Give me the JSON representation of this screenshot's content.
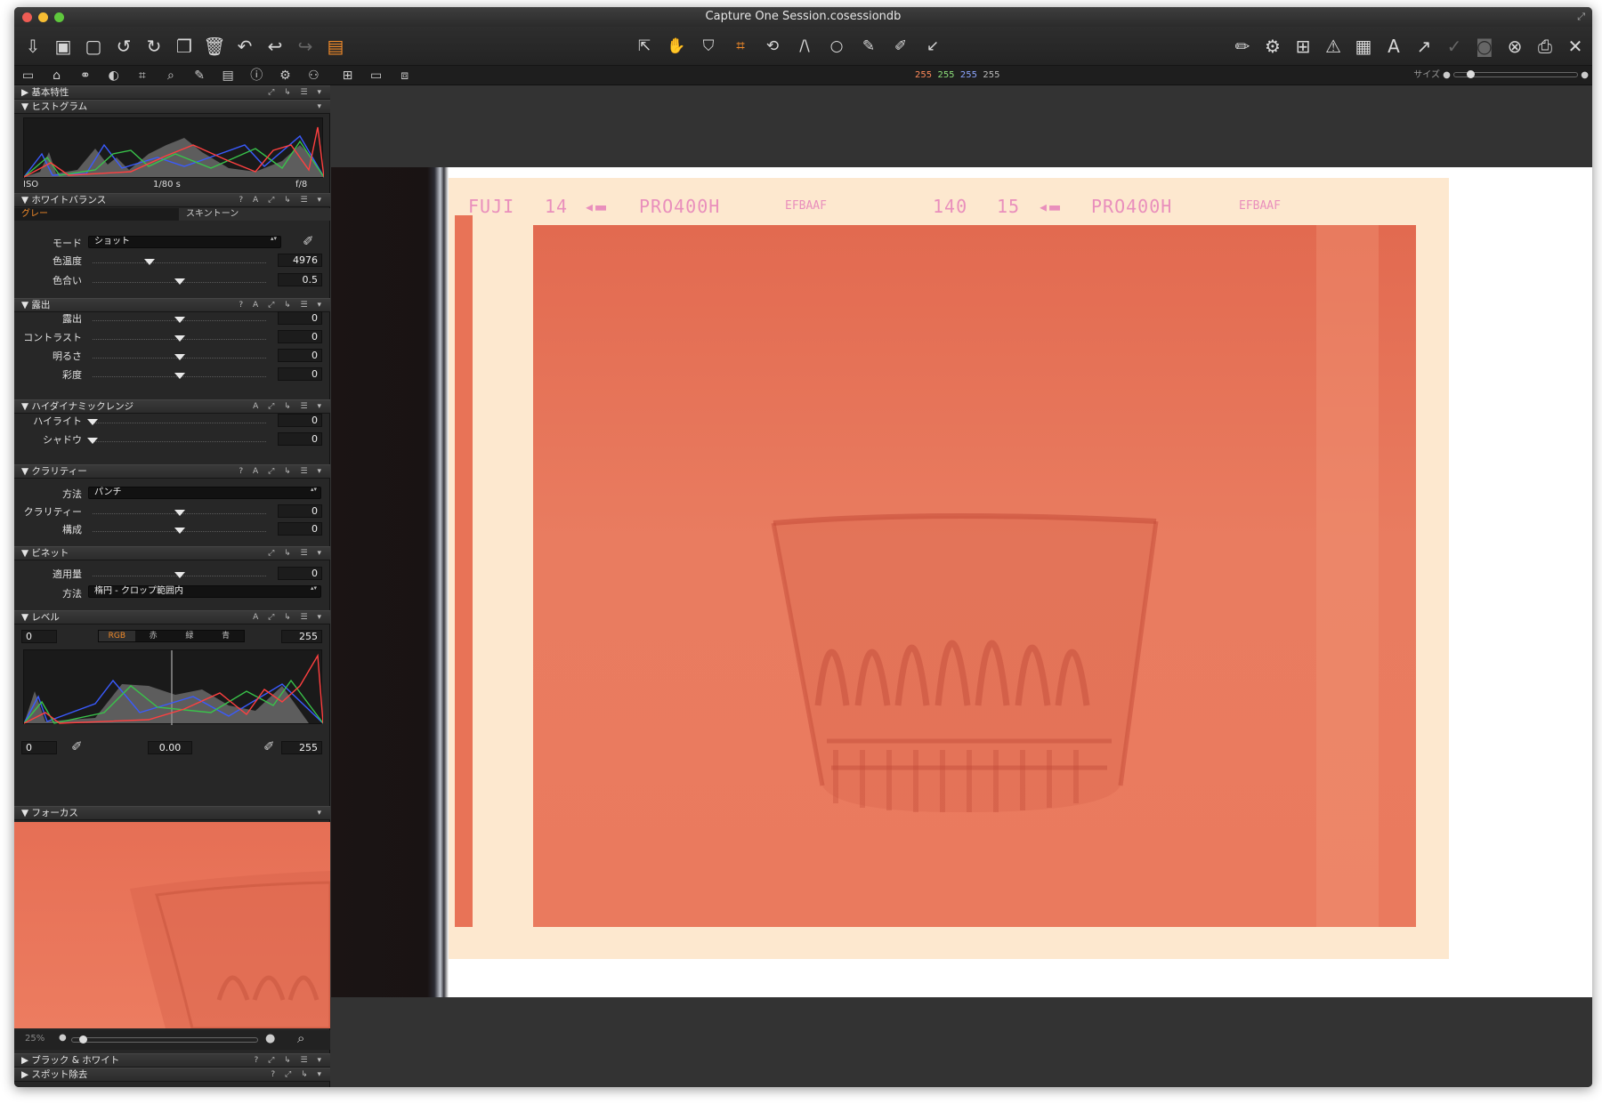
{
  "window": {
    "title": "Capture One Session.cosessiondb"
  },
  "readout": {
    "r": "255",
    "g": "255",
    "b": "255",
    "l": "255",
    "size_label": "サイズ"
  },
  "histogram": {
    "title": "ヒストグラム",
    "iso": "ISO",
    "shutter": "1/80 s",
    "aperture": "f/8"
  },
  "basic": {
    "title": "基本特性"
  },
  "wb": {
    "title": "ホワイトバランス",
    "tab_gray": "グレー",
    "tab_skin": "スキントーン",
    "mode_label": "モード",
    "mode_value": "ショット",
    "temp_label": "色温度",
    "temp_value": "4976",
    "temp_pos": 0.33,
    "tint_label": "色合い",
    "tint_value": "0.5",
    "tint_pos": 0.5
  },
  "exposure": {
    "title": "露出",
    "rows": [
      {
        "label": "露出",
        "value": "0",
        "pos": 0.5
      },
      {
        "label": "コントラスト",
        "value": "0",
        "pos": 0.5
      },
      {
        "label": "明るさ",
        "value": "0",
        "pos": 0.5
      },
      {
        "label": "彩度",
        "value": "0",
        "pos": 0.5
      }
    ]
  },
  "hdr": {
    "title": "ハイダイナミックレンジ",
    "rows": [
      {
        "label": "ハイライト",
        "value": "0",
        "pos": 0.0
      },
      {
        "label": "シャドウ",
        "value": "0",
        "pos": 0.0
      }
    ]
  },
  "clarity": {
    "title": "クラリティー",
    "method_label": "方法",
    "method_value": "パンチ",
    "rows": [
      {
        "label": "クラリティー",
        "value": "0",
        "pos": 0.5
      },
      {
        "label": "構成",
        "value": "0",
        "pos": 0.5
      }
    ]
  },
  "vignette": {
    "title": "ビネット",
    "amount_label": "適用量",
    "amount_value": "0",
    "amount_pos": 0.5,
    "method_label": "方法",
    "method_value": "楕円 - クロップ範囲内"
  },
  "levels": {
    "title": "レベル",
    "low": "0",
    "high": "255",
    "tabs": [
      "RGB",
      "赤",
      "緑",
      "青"
    ],
    "out_low": "0",
    "mid": "0.00",
    "out_high": "255"
  },
  "focus": {
    "title": "フォーカス",
    "zoom": "25%"
  },
  "bw": {
    "title": "ブラック & ホワイト"
  },
  "spot": {
    "title": "スポット除去"
  },
  "film_edge": {
    "t1": "FUJI",
    "t2": "14",
    "t3": "PRO400H",
    "t4": "EFBAAF",
    "t5": "140",
    "t6": "15",
    "t7": "PRO400H",
    "t8": "EFBAAF"
  },
  "colors": {
    "accent": "#f08a2a",
    "panel": "#272727",
    "header": "#333333"
  }
}
